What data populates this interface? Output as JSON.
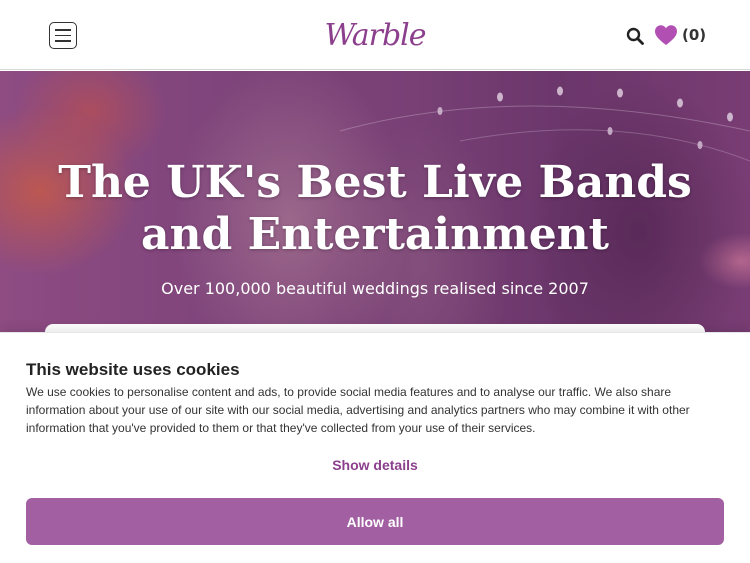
{
  "header": {
    "logo_text": "Warble",
    "wishlist_count": "(0)"
  },
  "hero": {
    "title": "The UK's Best Live Bands and Entertainment",
    "subtitle": "Over 100,000 beautiful weddings realised since 2007"
  },
  "cookie_banner": {
    "title": "This website uses cookies",
    "body": "We use cookies to personalise content and ads, to provide social media features and to analyse our traffic. We also share information about your use of our site with our social media, advertising and analytics partners who may combine it with other information that you've provided to them or that they've collected from your use of their services.",
    "show_details_label": "Show details",
    "allow_all_label": "Allow all"
  },
  "icons": {
    "menu": "menu-icon",
    "search": "search-icon",
    "wishlist": "heart-icon"
  },
  "colors": {
    "brand": "#8c3f8c",
    "button": "#a260a2",
    "heart": "#b24fb2"
  }
}
